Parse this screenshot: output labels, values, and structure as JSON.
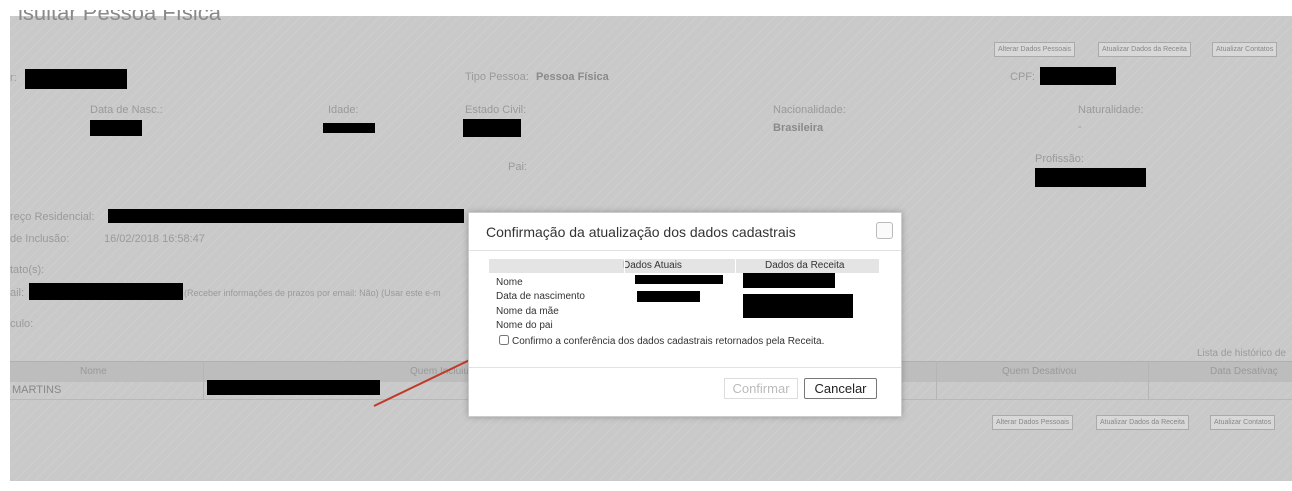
{
  "page": {
    "title": "isultar Pessoa Física",
    "toolbar_top": [
      "Alterar Dados Pessoais",
      "Atualizar Dados da Receita",
      "Atualizar Contatos"
    ],
    "toolbar_bottom": [
      "Alterar Dados Pessoais",
      "Atualizar Dados da Receita",
      "Atualizar Contatos"
    ],
    "fields": {
      "r_label": "r:",
      "tipo_pessoa_label": "Tipo Pessoa:",
      "tipo_pessoa_value": "Pessoa Física",
      "cpf_label": "CPF:",
      "data_nasc_label": "Data de Nasc.:",
      "idade_label": "Idade:",
      "estado_civil_label": "Estado Civil:",
      "nacionalidade_label": "Nacionalidade:",
      "nacionalidade_value": "Brasileira",
      "naturalidade_label": "Naturalidade:",
      "naturalidade_value": "-",
      "pai_label": "Pai:",
      "profissao_label": "Profissão:",
      "endereco_label": "reço Residencial:",
      "inclusao_label": "de Inclusão:",
      "inclusao_value": "16/02/2018 16:58:47",
      "contatos_label": "tato(s):",
      "email_label": "ail:",
      "email_note": "(Receber informações de prazos por email: Não) (Usar este e-m",
      "vinculo_label": "culo:"
    },
    "history_link": "Lista de histórico de",
    "grid": {
      "headers": [
        "Nome",
        "Quem Incluiu",
        "Quem Desativou",
        "Data Desativaç"
      ],
      "row_name": "MARTINS"
    }
  },
  "modal": {
    "title": "Confirmação da atualização dos dados cadastrais",
    "col_atual": "Dados Atuais",
    "col_receita": "Dados da Receita",
    "rows": [
      "Nome",
      "Data de nascimento",
      "Nome da mãe",
      "Nome do pai"
    ],
    "confirm_text": "Confirmo a conferência dos dados cadastrais retornados pela Receita.",
    "btn_confirm": "Confirmar",
    "btn_cancel": "Cancelar"
  },
  "colors": {
    "arrow": "#c0392b",
    "overlay": "#c9c9c9"
  }
}
